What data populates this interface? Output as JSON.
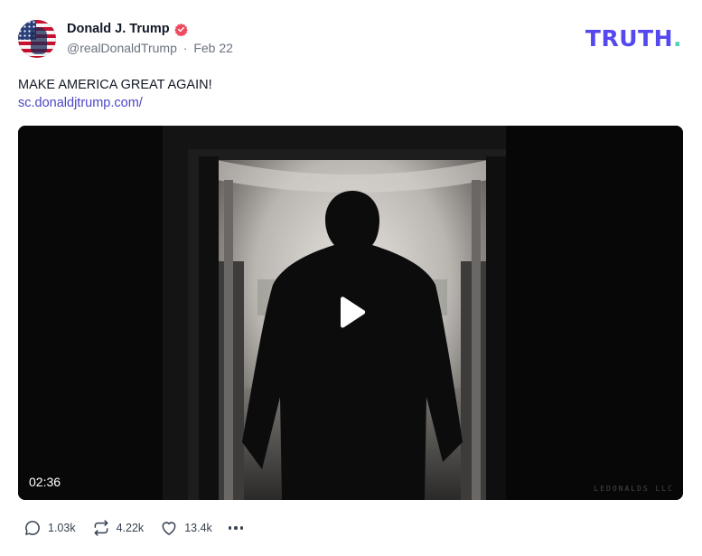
{
  "author": {
    "display_name": "Donald J. Trump",
    "handle": "@realDonaldTrump",
    "separator": "·",
    "date": "Feb 22",
    "verified_badge_color": "#ef4a5f"
  },
  "brand": {
    "logo_text": "TRUTH",
    "logo_period": ".",
    "logo_color": "#5448ee",
    "period_color": "#4fd1b7"
  },
  "post": {
    "text": "MAKE AMERICA GREAT AGAIN!",
    "link_text": "sc.donaldjtrump.com/"
  },
  "video": {
    "duration": "02:36",
    "watermark": "LEDONALDS LLC",
    "play_icon": "play-icon"
  },
  "actions": {
    "replies": "1.03k",
    "retruths": "4.22k",
    "likes": "13.4k"
  }
}
